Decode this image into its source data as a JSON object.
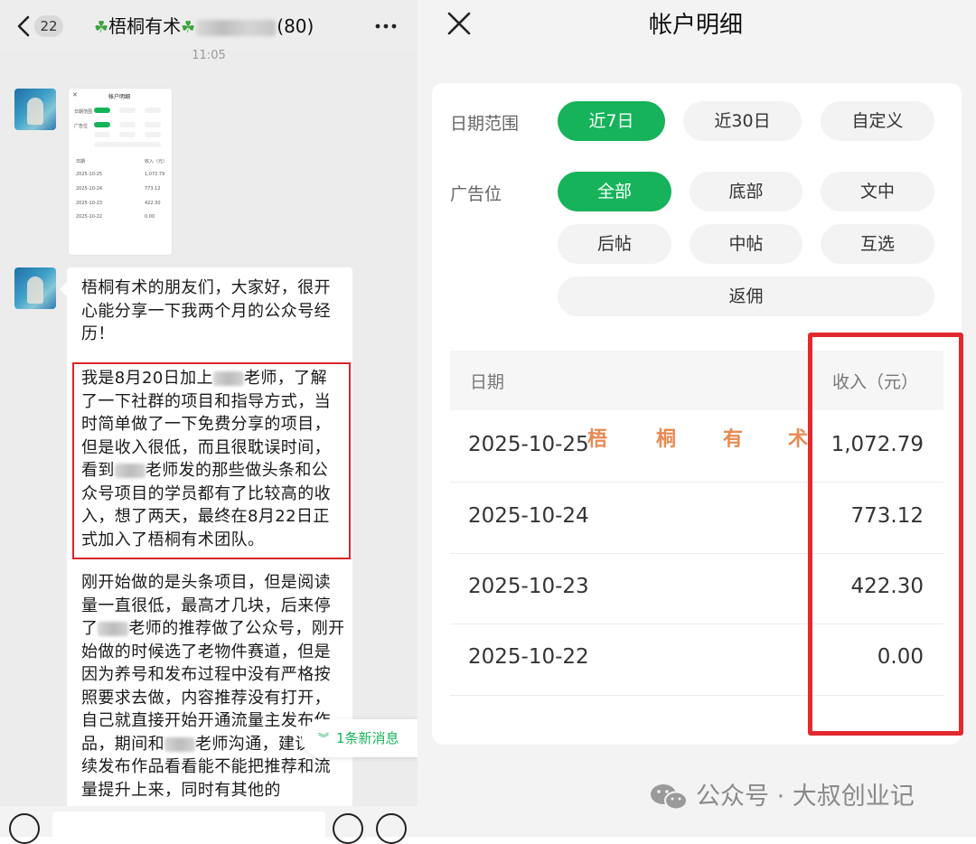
{
  "chat": {
    "unread": "22",
    "title_prefix": "梧桐有术",
    "title_count": "(80)",
    "time": "11:05",
    "thumbnail": {
      "title": "帐户明细",
      "rows": [
        {
          "date": "2025-10-25",
          "value": "1,072.79"
        },
        {
          "date": "2025-10-24",
          "value": "773.12"
        },
        {
          "date": "2025-10-23",
          "value": "422.30"
        },
        {
          "date": "2025-10-22",
          "value": "0.00"
        }
      ]
    },
    "para1": "梧桐有术的朋友们，大家好，很开心能分享一下我两个月的公众号经历！",
    "para2": {
      "a": "我是8月20日加上",
      "b": "老师，了解了一下社群的项目和指导方式，当时简单做了一下免费分享的项目，但是收入很低，而且很耽误时间，看到",
      "c": "老师发的那些做头条和公众号项目的学员都有了比较高的收入，想了两天，最终在8月22日正式加入了梧桐有术团队。"
    },
    "para3": {
      "a": "刚开始做的是头条项目，但是阅读量一直很低，最高才几块，后来停了",
      "b": "老师的推荐做了公众号，刚开始做的时候选了老物件赛道，但是因为养号和发布过程中没有严格按照要求去做，内容推荐没有打开，自己就直接开始开通流量主发布作品，期间和",
      "c": "老师沟通，建议我持续发布作品看看能不能把推荐和流量提升上来，同时有其他的"
    },
    "new_messages": "1条新消息"
  },
  "account": {
    "title": "帐户明细",
    "date_range_label": "日期范围",
    "date_ranges": [
      "近7日",
      "近30日",
      "自定义"
    ],
    "ad_slot_label": "广告位",
    "ad_slots": [
      "全部",
      "底部",
      "文中",
      "后帖",
      "中帖",
      "互选",
      "返佣"
    ],
    "selected_range": "近7日",
    "selected_slot": "全部",
    "table": {
      "col_date": "日期",
      "col_income": "收入（元）",
      "rows": [
        {
          "date": "2025-10-25",
          "income": "1,072.79"
        },
        {
          "date": "2025-10-24",
          "income": "773.12"
        },
        {
          "date": "2025-10-23",
          "income": "422.30"
        },
        {
          "date": "2025-10-22",
          "income": "0.00"
        }
      ]
    },
    "inline_watermark": [
      "梧",
      "桐",
      "有",
      "术"
    ]
  },
  "footer_watermark": "公众号 · 大叔创业记",
  "colors": {
    "accent_green": "#16b35a",
    "highlight_red": "#e02a2f",
    "chat_bg": "#ececec"
  }
}
